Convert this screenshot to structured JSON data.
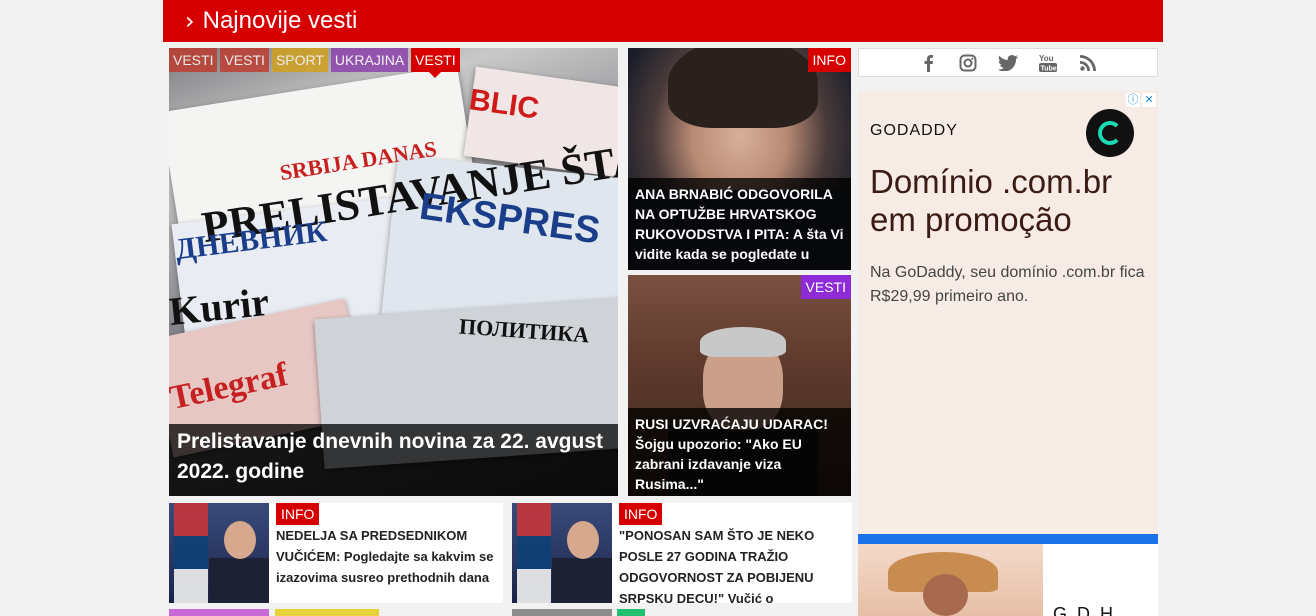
{
  "section": {
    "chevron": "›",
    "title": "Najnovije vesti"
  },
  "hero": {
    "tags": [
      "VESTI",
      "VESTI",
      "SPORT",
      "UKRAJINA",
      "VESTI"
    ],
    "title": "Prelistavanje dnevnih novina za 22. avgust 2022. godine",
    "mastheads": [
      "PRELISTAVANJE ŠTAMPE",
      "ДНЕВНИК",
      "EKSPRES",
      "Kurir",
      "Telegraf",
      "BLIC",
      "ПОЛИТИКА",
      "SRBIJA DANAS"
    ]
  },
  "side_cards": [
    {
      "tag": "INFO",
      "title": "ANA BRNABIĆ ODGOVORILA NA OPTUŽBE HRVATSKOG RUKOVODSTVA I PITA: A šta Vi vidite kada se pogledate u"
    },
    {
      "tag": "VESTI",
      "title": "RUSI UZVRAĆAJU UDARAC! Šojgu upozorio: \"Ako EU zabrani izdavanje viza Rusima...\""
    }
  ],
  "row_items": [
    {
      "tag": "INFO",
      "title_upper": "NEDELJA SA PREDSEDNIKOM VUČIĆEM:",
      "title_rest": " Pogledajte sa kakvim se izazovima susreo prethodnih dana"
    },
    {
      "tag": "INFO",
      "title_upper": "\"PONOSAN SAM ŠTO JE NEKO POSLE 27 GODINA TRAŽIO ODGOVORNOST ZA POBIJENU SRPSKU DECU!\"",
      "title_rest": " Vučić o"
    }
  ],
  "social": {
    "icons": [
      "facebook-icon",
      "instagram-icon",
      "twitter-icon",
      "youtube-icon",
      "rss-icon"
    ],
    "color": "#666666"
  },
  "ad": {
    "brand": "GODADDY",
    "headline": "Domínio .com.br em promoção",
    "body": "Na GoDaddy, seu domínio .com.br fica R$29,99 primeiro ano.",
    "info_icon": "ⓘ",
    "close_icon": "✕"
  },
  "ad2": {
    "brand_partial": "G. D. H"
  },
  "colors": {
    "brand_red": "#d60000",
    "tag_purple": "#8e2bd6",
    "tag_sport": "#d4a017",
    "ad_bg": "#f7ebe6",
    "ad_blue": "#1a73e8"
  }
}
